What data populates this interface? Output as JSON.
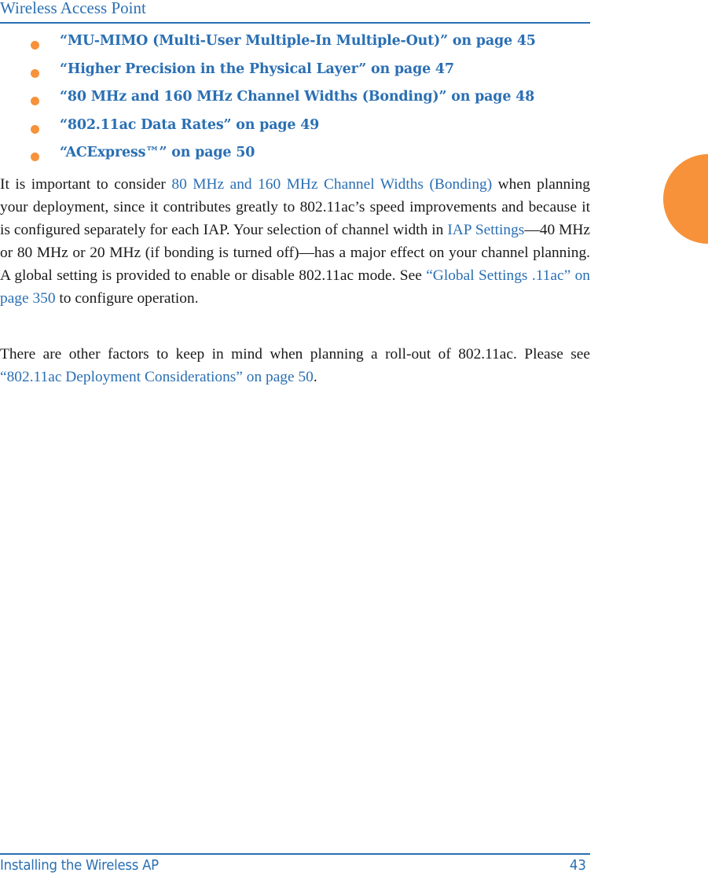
{
  "header": {
    "title": "Wireless Access Point"
  },
  "bullets": [
    {
      "text": "“MU-MIMO (Multi-User Multiple-In Multiple-Out)” on page 45"
    },
    {
      "text": "“Higher Precision in the Physical Layer” on page 47"
    },
    {
      "text": "“80 MHz and 160 MHz Channel Widths (Bonding)” on page 48"
    },
    {
      "text": "“802.11ac Data Rates” on page 49"
    },
    {
      "text": "“ACExpress™” on page 50"
    }
  ],
  "paragraph1": {
    "t1": "It is important to consider ",
    "link1": "80 MHz and 160 MHz Channel Widths (Bonding)",
    "t2": " when planning your deployment, since it contributes greatly to 802.11ac’s speed improvements and because it is configured separately for each IAP. Your selection of channel width in ",
    "link2": "IAP Settings",
    "t3": "—40 MHz or 80 MHz or 20 MHz (if bonding is turned off)—has a major effect on your channel planning. A global setting is provided to enable or disable 802.11ac mode. See ",
    "link3": "“Global Settings .11ac” on page 350",
    "t4": " to configure operation."
  },
  "paragraph2": {
    "t1": "There are other factors to keep in mind when planning a roll-out of 802.11ac. Please see ",
    "link1": "“802.11ac Deployment Considerations” on page 50",
    "t2": "."
  },
  "footer": {
    "section": "Installing the Wireless AP",
    "page_number": "43"
  },
  "colors": {
    "accent_blue": "#2a6fb3",
    "bullet_orange": "#f7923a",
    "body_text": "#1a1a1a"
  }
}
